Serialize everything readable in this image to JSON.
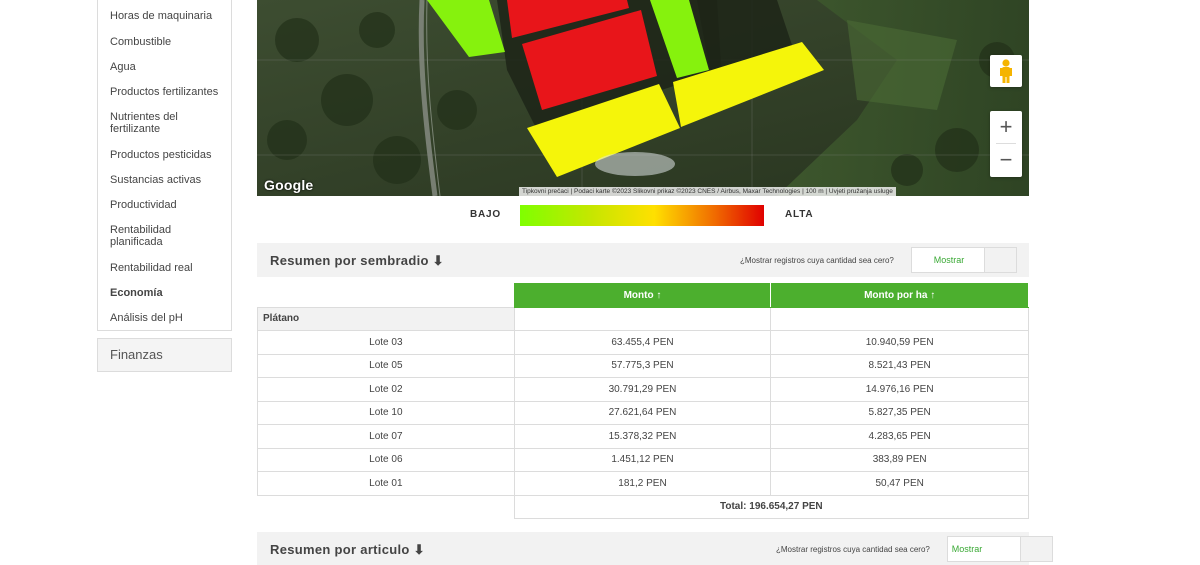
{
  "sidebar": {
    "items": [
      {
        "label": "Horas de maquinaria",
        "bold": false
      },
      {
        "label": "Combustible",
        "bold": false
      },
      {
        "label": "Agua",
        "bold": false
      },
      {
        "label": "Productos fertilizantes",
        "bold": false
      },
      {
        "label": "Nutrientes del fertilizante",
        "bold": false
      },
      {
        "label": "Productos pesticidas",
        "bold": false
      },
      {
        "label": "Sustancias activas",
        "bold": false
      },
      {
        "label": "Productividad",
        "bold": false
      },
      {
        "label": "Rentabilidad planificada",
        "bold": false
      },
      {
        "label": "Rentabilidad real",
        "bold": false
      },
      {
        "label": "Economía",
        "bold": true
      },
      {
        "label": "Análisis del pH",
        "bold": false
      }
    ],
    "section_label": "Finanzas"
  },
  "map": {
    "logo": "Google",
    "attribution": "Tipkovni prečaci | Podaci karte ©2023 Slikovni prikaz ©2023 CNES / Airbus, Maxar Technologies | 100 m | Uvjeti pružanja usluge",
    "zoom_in": "+",
    "zoom_out": "−",
    "pegman_icon": "pegman-icon",
    "plot_colors": {
      "high": "#e8151a",
      "medium": "#f5f50a",
      "low": "#86f20d"
    }
  },
  "legend": {
    "low_label": "BAJO",
    "high_label": "ALTA",
    "gradient_colors": [
      "#7fff00",
      "#ffe000",
      "#e00000"
    ]
  },
  "summary_sowing": {
    "title": "Resumen por sembradio",
    "title_icon": "arrow-down-icon",
    "question": "¿Mostrar registros cuya cantidad sea cero?",
    "toggle_label": "Mostrar",
    "columns": [
      "Monto ↑",
      "Monto por ha ↑"
    ],
    "crop": "Plátano",
    "rows": [
      {
        "lot": "Lote 03",
        "amount": "63.455,4 PEN",
        "per_ha": "10.940,59 PEN"
      },
      {
        "lot": "Lote 05",
        "amount": "57.775,3 PEN",
        "per_ha": "8.521,43 PEN"
      },
      {
        "lot": "Lote 02",
        "amount": "30.791,29 PEN",
        "per_ha": "14.976,16 PEN"
      },
      {
        "lot": "Lote 10",
        "amount": "27.621,64 PEN",
        "per_ha": "5.827,35 PEN"
      },
      {
        "lot": "Lote 07",
        "amount": "15.378,32 PEN",
        "per_ha": "4.283,65 PEN"
      },
      {
        "lot": "Lote 06",
        "amount": "1.451,12 PEN",
        "per_ha": "383,89 PEN"
      },
      {
        "lot": "Lote 01",
        "amount": "181,2 PEN",
        "per_ha": "50,47 PEN"
      }
    ],
    "total": "Total: 196.654,27 PEN"
  },
  "summary_article": {
    "title": "Resumen por articulo",
    "title_icon": "arrow-down-icon",
    "question": "¿Mostrar registros cuya cantidad sea cero?",
    "toggle_label": "Mostrar"
  }
}
